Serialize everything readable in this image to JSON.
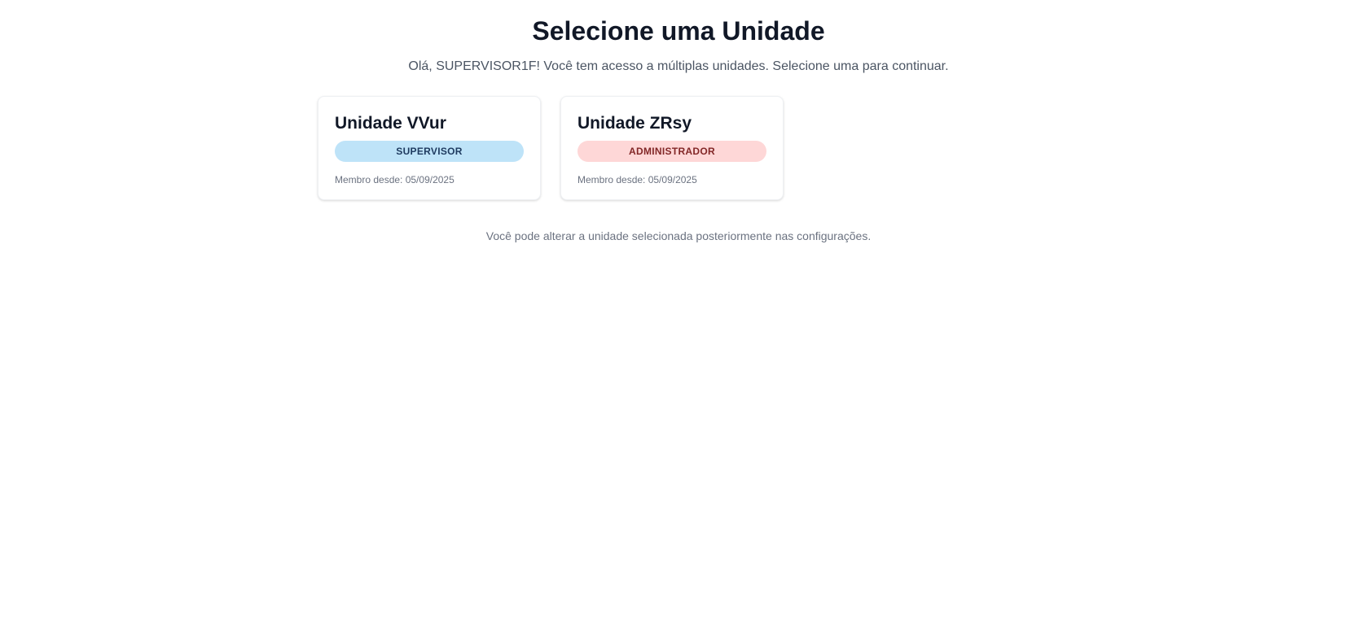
{
  "header": {
    "title": "Selecione uma Unidade",
    "subtitle": "Olá, SUPERVISOR1F! Você tem acesso a múltiplas unidades. Selecione uma para continuar."
  },
  "units": [
    {
      "name": "Unidade VVur",
      "role": "SUPERVISOR",
      "member_since": "Membro desde: 05/09/2025"
    },
    {
      "name": "Unidade ZRsy",
      "role": "ADMINISTRADOR",
      "member_since": "Membro desde: 05/09/2025"
    }
  ],
  "footer": {
    "note": "Você pode alterar a unidade selecionada posteriormente nas configurações."
  },
  "colors": {
    "supervisor_badge_bg": "#bee3f8",
    "supervisor_badge_text": "#1e3a5f",
    "admin_badge_bg": "#fed7d7",
    "admin_badge_text": "#822727"
  }
}
